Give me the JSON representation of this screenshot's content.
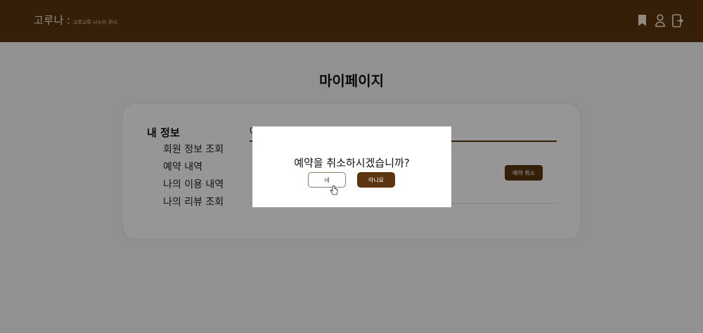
{
  "header": {
    "brand_title": "고루나",
    "brand_separator": ":",
    "brand_tagline": "고루고루 나누어 주다.",
    "icons": [
      "bookmark-icon",
      "user-icon",
      "logout-icon"
    ],
    "background_color": "#5a3510"
  },
  "page": {
    "title": "마이페이지"
  },
  "sidebar": {
    "heading": "내 정보",
    "items": [
      {
        "label": "회원 정보 조회"
      },
      {
        "label": "예약 내역"
      },
      {
        "label": "나의 이용 내역"
      },
      {
        "label": "나의 리뷰 조회"
      }
    ]
  },
  "content": {
    "partial_heading": "예",
    "cancel_reservation_label": "예약 취소"
  },
  "modal": {
    "message": "예약을 취소하시겠습니까?",
    "yes_label": "네",
    "no_label": "아니요"
  },
  "colors": {
    "accent": "#5a3510",
    "overlay": "rgba(0,0,0,0.4)"
  }
}
